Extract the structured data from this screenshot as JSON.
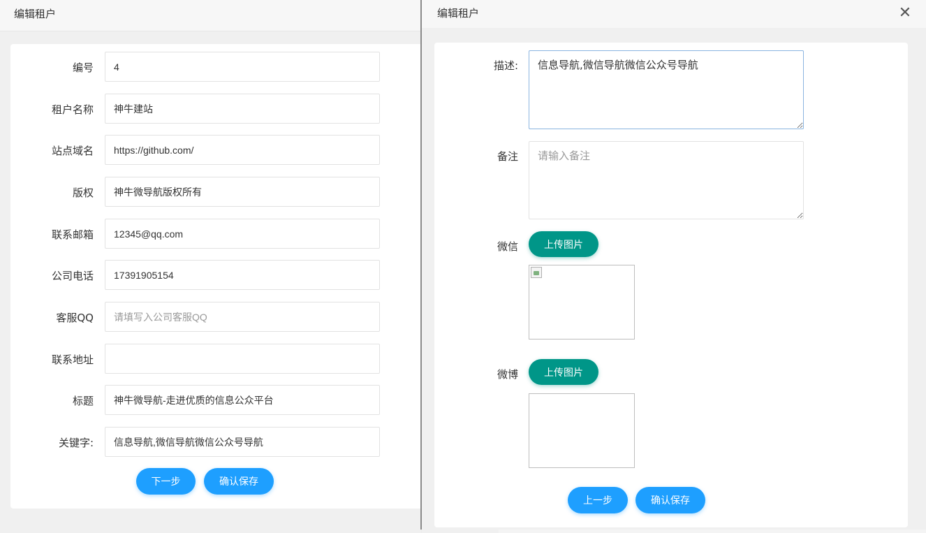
{
  "left_dialog": {
    "title": "编辑租户",
    "fields": [
      {
        "label": "编号",
        "value": "4",
        "placeholder": ""
      },
      {
        "label": "租户名称",
        "value": "神牛建站",
        "placeholder": ""
      },
      {
        "label": "站点域名",
        "value": "https://github.com/",
        "placeholder": ""
      },
      {
        "label": "版权",
        "value": "神牛微导航版权所有",
        "placeholder": ""
      },
      {
        "label": "联系邮箱",
        "value": "12345@qq.com",
        "placeholder": ""
      },
      {
        "label": "公司电话",
        "value": "17391905154",
        "placeholder": ""
      },
      {
        "label": "客服QQ",
        "value": "",
        "placeholder": "请填写入公司客服QQ"
      },
      {
        "label": "联系地址",
        "value": "",
        "placeholder": ""
      },
      {
        "label": "标题",
        "value": "神牛微导航-走进优质的信息公众平台",
        "placeholder": ""
      },
      {
        "label": "关键字:",
        "value": "信息导航,微信导航微信公众号导航",
        "placeholder": ""
      }
    ],
    "next_label": "下一步",
    "save_label": "确认保存"
  },
  "right_dialog": {
    "title": "编辑租户",
    "close_icon": "close-icon",
    "description_label": "描述:",
    "description_value": "信息导航,微信导航微信公众号导航",
    "remark_label": "备注",
    "remark_placeholder": "请输入备注",
    "wechat_label": "微信",
    "weibo_label": "微博",
    "upload_label": "上传图片",
    "prev_label": "上一步",
    "save_label": "确认保存"
  },
  "colors": {
    "primary_blue": "#1e9fff",
    "upload_green": "#009688"
  }
}
